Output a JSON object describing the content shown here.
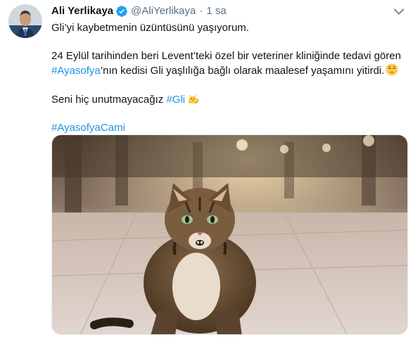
{
  "tweet": {
    "author": {
      "name": "Ali Yerlikaya",
      "handle": "@AliYerlikaya",
      "verified": true
    },
    "separator": "·",
    "timestamp": "1 sa",
    "lines": {
      "line1": "Gli’yi kaybetmenin üzüntüsünü yaşıyorum.",
      "line2": "24 Eylül tarihinden beri Levent’teki özel bir veteriner kliniğinde tedavi gören",
      "line3_hashtag": "#Ayasofya",
      "line3_rest": "’nın kedisi Gli yaşlılığa bağlı olarak maalesef yaşamını yitirdi.",
      "line4_text": "Seni hiç unutmayacağız ",
      "line4_hashtag": "#Gli",
      "line5_hashtag": "#AyasofyaCami"
    },
    "emojis": [
      "pensive-face",
      "cat"
    ],
    "media": {
      "description_icon": "cat-photo"
    },
    "colors": {
      "link": "#1b95e0",
      "verified": "#1da1f2",
      "muted": "#5b7083"
    }
  }
}
